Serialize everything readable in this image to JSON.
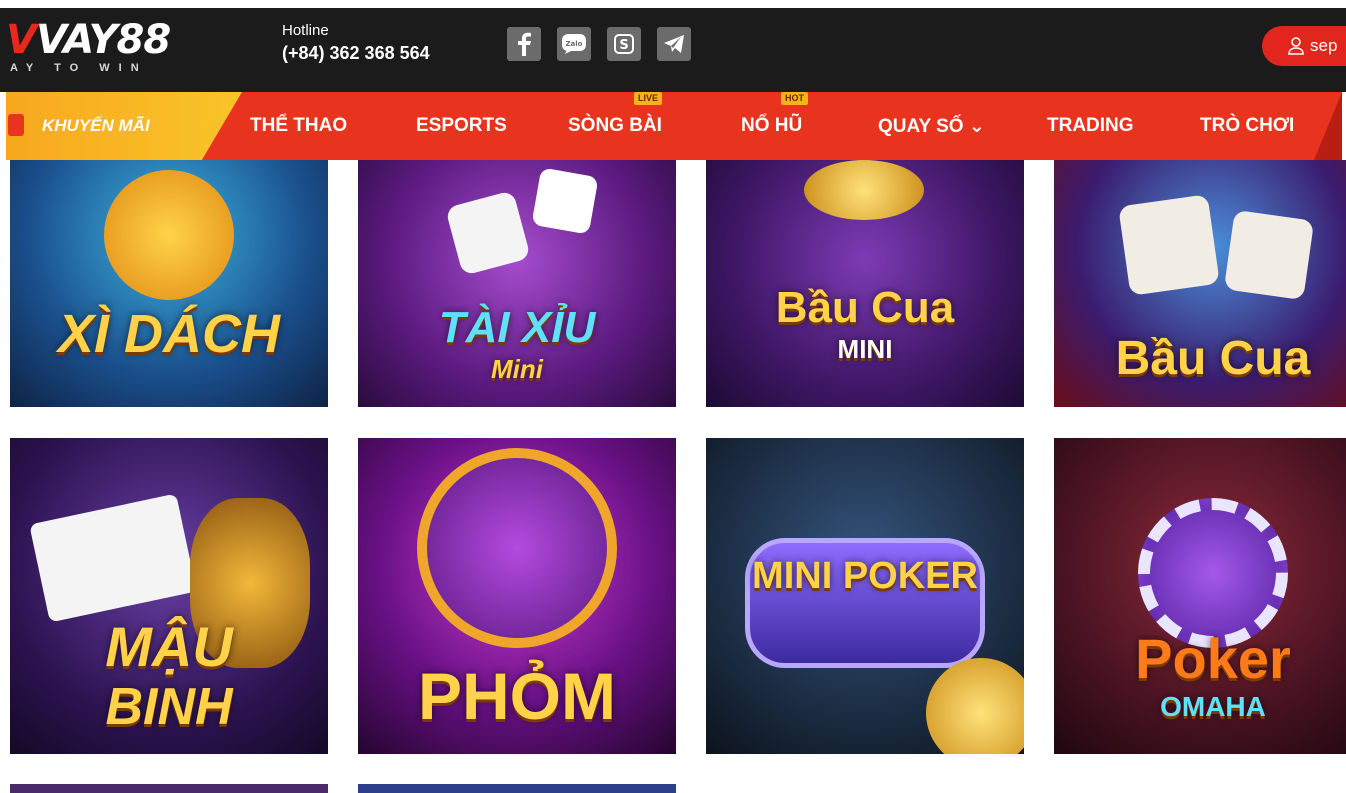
{
  "header": {
    "logo_main": "VAY88",
    "logo_tagline": "AY TO WIN",
    "hotline_label": "Hotline",
    "hotline_number": "(+84) 362 368 564",
    "socials": [
      {
        "name": "facebook-icon",
        "glyph": "f"
      },
      {
        "name": "zalo-icon",
        "glyph": "Zalo"
      },
      {
        "name": "skype-icon",
        "glyph": "S"
      },
      {
        "name": "telegram-icon",
        "glyph": "➤"
      }
    ],
    "login_label": "sep"
  },
  "nav": {
    "promo": "KHUYẾN MÃI",
    "items": [
      {
        "label": "THỂ THAO",
        "badge": ""
      },
      {
        "label": "ESPORTS",
        "badge": ""
      },
      {
        "label": "SÒNG BÀI",
        "badge": "LIVE"
      },
      {
        "label": "NỔ HŨ",
        "badge": "HOT"
      },
      {
        "label": "QUAY SỐ ⌄",
        "badge": ""
      },
      {
        "label": "TRADING",
        "badge": ""
      },
      {
        "label": "TRÒ CHƠI",
        "badge": ""
      }
    ]
  },
  "games": [
    {
      "title": "XÌ DÁCH",
      "subtitle": ""
    },
    {
      "title": "TÀI XỈU",
      "subtitle": "Mini"
    },
    {
      "title": "Bầu Cua",
      "subtitle": "MINI"
    },
    {
      "title": "Bầu Cua",
      "subtitle": ""
    },
    {
      "title": "MẬU",
      "subtitle": "BINH"
    },
    {
      "title": "PHỎM",
      "subtitle": ""
    },
    {
      "title": "MINI POKER",
      "subtitle": ""
    },
    {
      "title": "Poker",
      "subtitle": "OMAHA"
    }
  ],
  "colors": {
    "header_bg": "#1b1b1b",
    "nav_bg": "#e8331e",
    "promo_bg": "#f9c42a",
    "accent_red": "#e3261d"
  }
}
